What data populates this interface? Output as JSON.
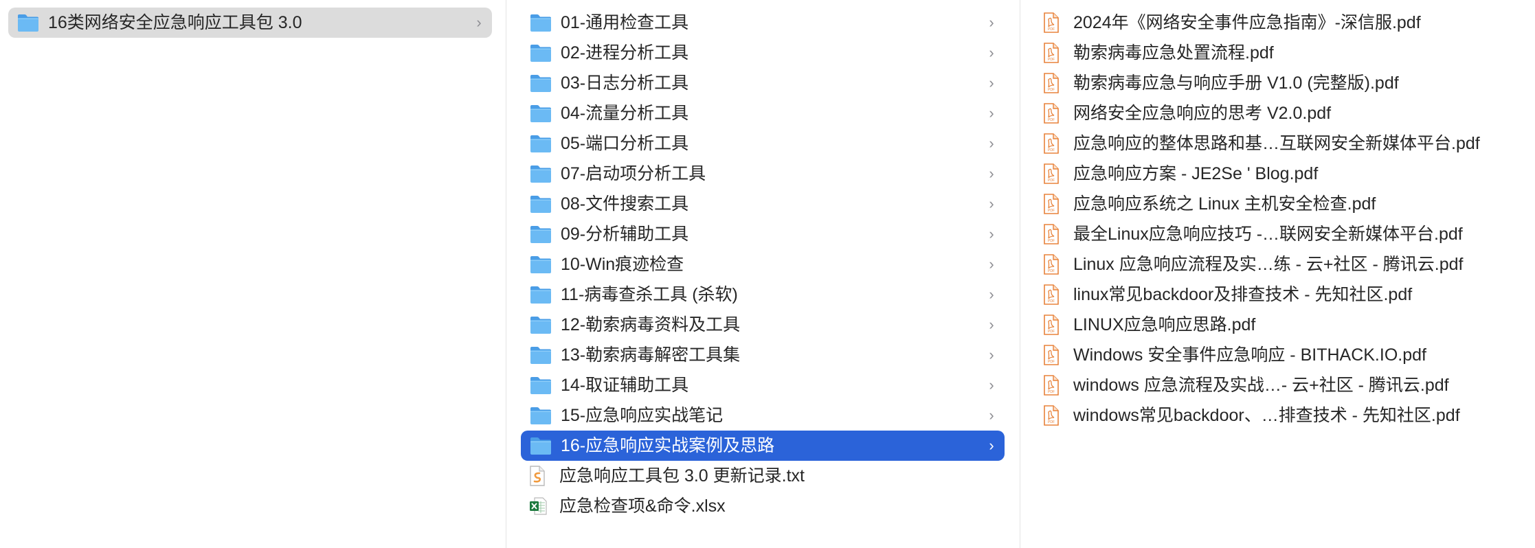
{
  "columns": {
    "col1": {
      "items": [
        {
          "label": "16类网络安全应急响应工具包 3.0",
          "type": "folder",
          "selected": "gray"
        }
      ]
    },
    "col2": {
      "items": [
        {
          "label": "01-通用检查工具",
          "type": "folder"
        },
        {
          "label": "02-进程分析工具",
          "type": "folder"
        },
        {
          "label": "03-日志分析工具",
          "type": "folder"
        },
        {
          "label": "04-流量分析工具",
          "type": "folder"
        },
        {
          "label": "05-端口分析工具",
          "type": "folder"
        },
        {
          "label": "07-启动项分析工具",
          "type": "folder"
        },
        {
          "label": "08-文件搜索工具",
          "type": "folder"
        },
        {
          "label": "09-分析辅助工具",
          "type": "folder"
        },
        {
          "label": "10-Win痕迹检查",
          "type": "folder"
        },
        {
          "label": "11-病毒查杀工具 (杀软)",
          "type": "folder"
        },
        {
          "label": "12-勒索病毒资料及工具",
          "type": "folder"
        },
        {
          "label": "13-勒索病毒解密工具集",
          "type": "folder"
        },
        {
          "label": "14-取证辅助工具",
          "type": "folder"
        },
        {
          "label": "15-应急响应实战笔记",
          "type": "folder"
        },
        {
          "label": "16-应急响应实战案例及思路",
          "type": "folder",
          "selected": "blue"
        },
        {
          "label": "应急响应工具包 3.0 更新记录.txt",
          "type": "txt"
        },
        {
          "label": "应急检查项&命令.xlsx",
          "type": "xlsx"
        }
      ]
    },
    "col3": {
      "items": [
        {
          "label": "2024年《网络安全事件应急指南》-深信服.pdf",
          "type": "pdf"
        },
        {
          "label": "勒索病毒应急处置流程.pdf",
          "type": "pdf"
        },
        {
          "label": "勒索病毒应急与响应手册 V1.0 (完整版).pdf",
          "type": "pdf"
        },
        {
          "label": "网络安全应急响应的思考 V2.0.pdf",
          "type": "pdf"
        },
        {
          "label": "应急响应的整体思路和基…互联网安全新媒体平台.pdf",
          "type": "pdf"
        },
        {
          "label": "应急响应方案 - JE2Se ' Blog.pdf",
          "type": "pdf"
        },
        {
          "label": "应急响应系统之 Linux 主机安全检查.pdf",
          "type": "pdf"
        },
        {
          "label": "最全Linux应急响应技巧 -…联网安全新媒体平台.pdf",
          "type": "pdf"
        },
        {
          "label": "Linux 应急响应流程及实…练 - 云+社区 - 腾讯云.pdf",
          "type": "pdf"
        },
        {
          "label": "linux常见backdoor及排查技术 - 先知社区.pdf",
          "type": "pdf"
        },
        {
          "label": "LINUX应急响应思路.pdf",
          "type": "pdf"
        },
        {
          "label": "Windows 安全事件应急响应 - BITHACK.IO.pdf",
          "type": "pdf"
        },
        {
          "label": "windows 应急流程及实战…- 云+社区 - 腾讯云.pdf",
          "type": "pdf"
        },
        {
          "label": "windows常见backdoor、…排查技术 - 先知社区.pdf",
          "type": "pdf"
        }
      ]
    }
  },
  "icons": {
    "folder": "folder-icon",
    "pdf": "pdf-file-icon",
    "txt": "text-file-icon",
    "xlsx": "excel-file-icon",
    "chevron": "chevron-right-icon",
    "chevron_glyph": "›"
  },
  "colors": {
    "selection_blue": "#2b63d9",
    "selection_gray": "#dcdcdc",
    "folder_blue": "#5aaef0",
    "pdf_orange": "#e8823a",
    "excel_green": "#1d7a3e"
  }
}
